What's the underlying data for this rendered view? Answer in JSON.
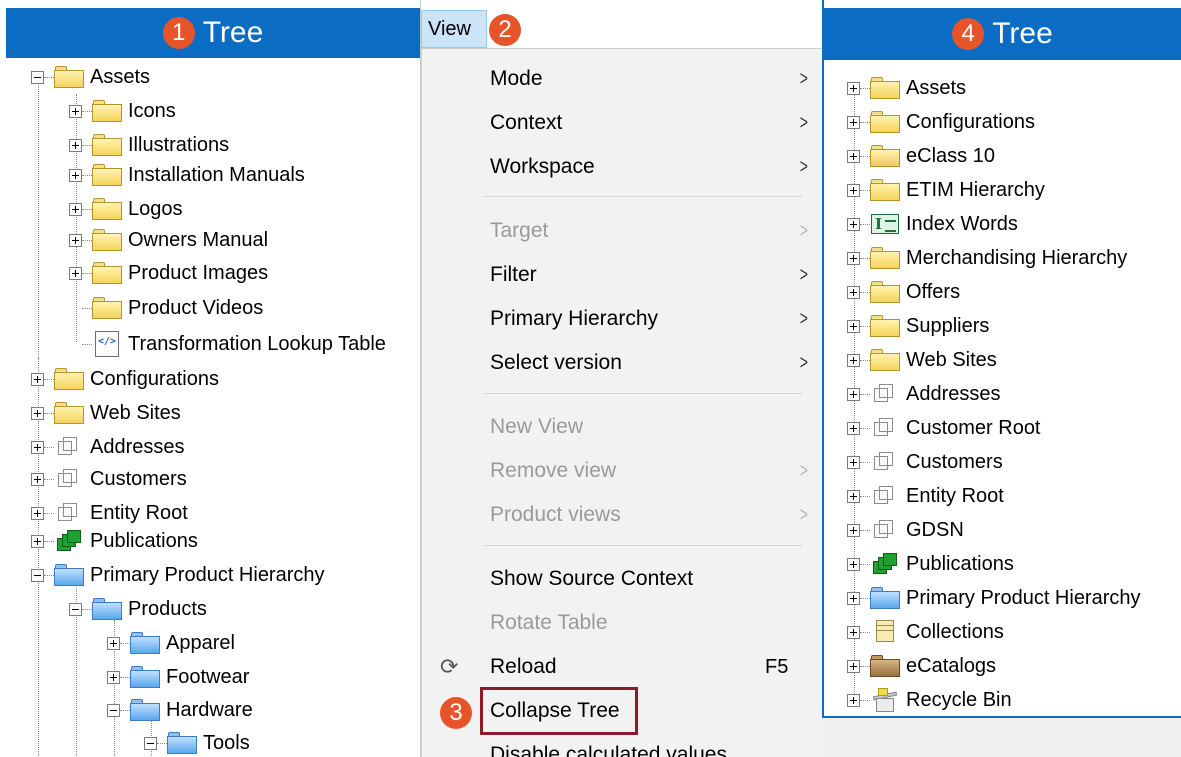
{
  "left_panel": {
    "badge": "1",
    "title": "Tree",
    "items": [
      {
        "label": "Assets"
      },
      {
        "label": "Icons"
      },
      {
        "label": "Illustrations"
      },
      {
        "label": "Installation Manuals"
      },
      {
        "label": "Logos"
      },
      {
        "label": "Owners Manual"
      },
      {
        "label": "Product Images"
      },
      {
        "label": "Product Videos"
      },
      {
        "label": "Transformation Lookup Table"
      },
      {
        "label": "Configurations"
      },
      {
        "label": "Web Sites"
      },
      {
        "label": "Addresses"
      },
      {
        "label": "Customers"
      },
      {
        "label": "Entity Root"
      },
      {
        "label": "Publications"
      },
      {
        "label": "Primary Product Hierarchy"
      },
      {
        "label": "Products"
      },
      {
        "label": "Apparel"
      },
      {
        "label": "Footwear"
      },
      {
        "label": "Hardware"
      },
      {
        "label": "Tools"
      }
    ]
  },
  "view_menu": {
    "button_label": "View",
    "badge": "2",
    "items": [
      {
        "label": "Mode"
      },
      {
        "label": "Context"
      },
      {
        "label": "Workspace"
      },
      {
        "label": "Target"
      },
      {
        "label": "Filter"
      },
      {
        "label": "Primary Hierarchy"
      },
      {
        "label": "Select version"
      },
      {
        "label": "New View"
      },
      {
        "label": "Remove view"
      },
      {
        "label": "Product views"
      },
      {
        "label": "Show Source Context"
      },
      {
        "label": "Rotate Table"
      },
      {
        "label": "Reload",
        "shortcut": "F5",
        "icon": "refresh-icon"
      },
      {
        "label": "Collapse Tree"
      },
      {
        "label": "Disable calculated values"
      }
    ],
    "submenu_arrow": ">",
    "reload_glyph": "⟳",
    "highlight_badge": "3",
    "highlight_color": "#8b1a2b"
  },
  "right_panel": {
    "badge": "4",
    "title": "Tree",
    "items": [
      {
        "label": "Assets"
      },
      {
        "label": "Configurations"
      },
      {
        "label": "eClass 10"
      },
      {
        "label": "ETIM Hierarchy"
      },
      {
        "label": "Index Words"
      },
      {
        "label": "Merchandising Hierarchy"
      },
      {
        "label": "Offers"
      },
      {
        "label": "Suppliers"
      },
      {
        "label": "Web Sites"
      },
      {
        "label": "Addresses"
      },
      {
        "label": "Customer Root"
      },
      {
        "label": "Customers"
      },
      {
        "label": "Entity Root"
      },
      {
        "label": "GDSN"
      },
      {
        "label": "Publications"
      },
      {
        "label": "Primary Product Hierarchy"
      },
      {
        "label": "Collections"
      },
      {
        "label": "eCatalogs"
      },
      {
        "label": "Recycle Bin"
      }
    ]
  },
  "colors": {
    "header_blue": "#0a6cc2",
    "badge_orange": "#e8542a",
    "menu_bg": "#f2f2f2",
    "view_button_bg": "#cce4f7"
  }
}
